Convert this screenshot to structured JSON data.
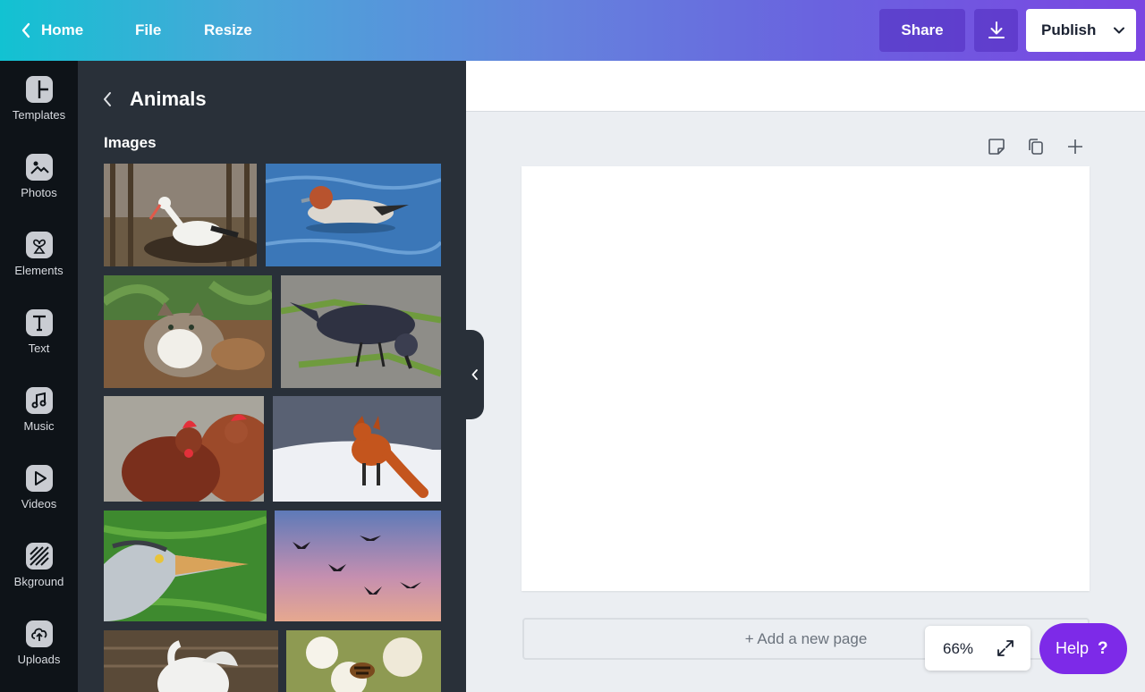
{
  "topbar": {
    "home_label": "Home",
    "file_label": "File",
    "resize_label": "Resize",
    "share_label": "Share",
    "publish_label": "Publish",
    "gradient_start": "#12c2d2",
    "gradient_end": "#7b46e2"
  },
  "rail": {
    "items": [
      {
        "label": "Templates",
        "icon": "templates-icon"
      },
      {
        "label": "Photos",
        "icon": "photos-icon"
      },
      {
        "label": "Elements",
        "icon": "elements-icon"
      },
      {
        "label": "Text",
        "icon": "text-icon"
      },
      {
        "label": "Music",
        "icon": "music-icon"
      },
      {
        "label": "Videos",
        "icon": "videos-icon"
      },
      {
        "label": "Bkground",
        "icon": "background-icon"
      },
      {
        "label": "Uploads",
        "icon": "uploads-icon"
      }
    ]
  },
  "panel": {
    "title": "Animals",
    "section_title": "Images",
    "images": [
      {
        "subject": "stork in nest"
      },
      {
        "subject": "duck on water"
      },
      {
        "subject": "cat in grass"
      },
      {
        "subject": "jackdaw"
      },
      {
        "subject": "chickens"
      },
      {
        "subject": "red fox in snow"
      },
      {
        "subject": "heron"
      },
      {
        "subject": "ducks flying at sunset"
      },
      {
        "subject": "swan"
      },
      {
        "subject": "bee on blossoms"
      }
    ]
  },
  "canvas": {
    "add_page_label": "+ Add a new page",
    "zoom": "66%",
    "help_label": "Help",
    "help_symbol": "?",
    "accent": "#7d2ae8"
  }
}
